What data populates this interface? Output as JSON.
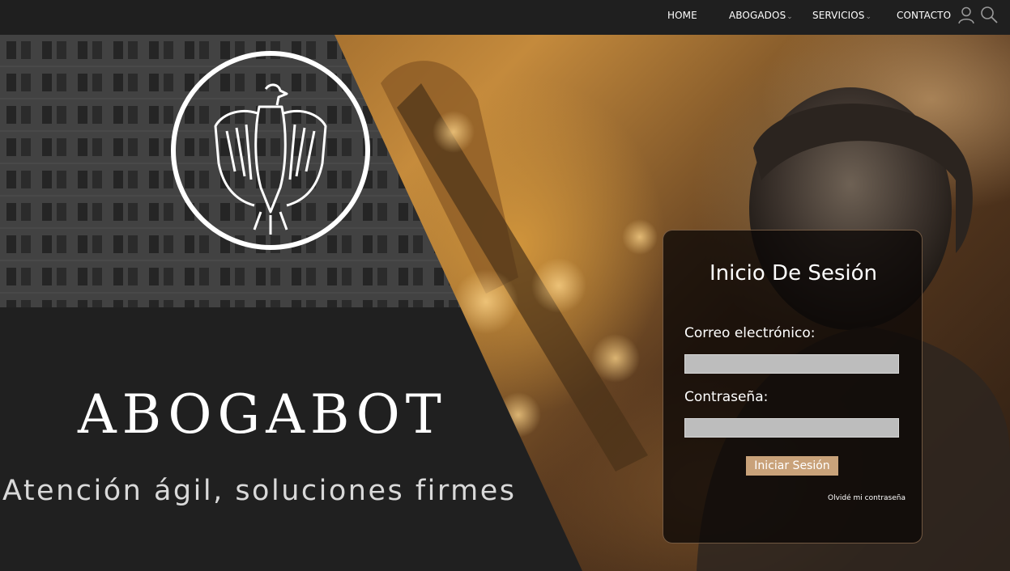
{
  "nav": {
    "items": [
      {
        "label": "HOME",
        "has_caret": false
      },
      {
        "label": "ABOGADOS",
        "has_caret": true
      },
      {
        "label": "SERVICIOS",
        "has_caret": true
      },
      {
        "label": "CONTACTO",
        "has_caret": false
      }
    ],
    "icons": [
      "user-icon",
      "search-icon"
    ],
    "caret_glyph": "⌄"
  },
  "brand": {
    "name": "ABOGABOT",
    "tagline": "Atención ágil, soluciones firmes",
    "emblem": "eagle-emblem"
  },
  "login": {
    "title": "Inicio De Sesión",
    "email_label": "Correo electrónico:",
    "email_value": "",
    "email_placeholder": "",
    "password_label": "Contraseña:",
    "password_value": "",
    "password_placeholder": "",
    "submit_label": "Iniciar Sesión",
    "forgot_label": "Olvidé mi contraseña"
  },
  "colors": {
    "topbar": "#1f1f1f",
    "panel_dark": "#1e1e1e",
    "button_accent": "#c9a27a",
    "text_light": "#ffffff"
  }
}
